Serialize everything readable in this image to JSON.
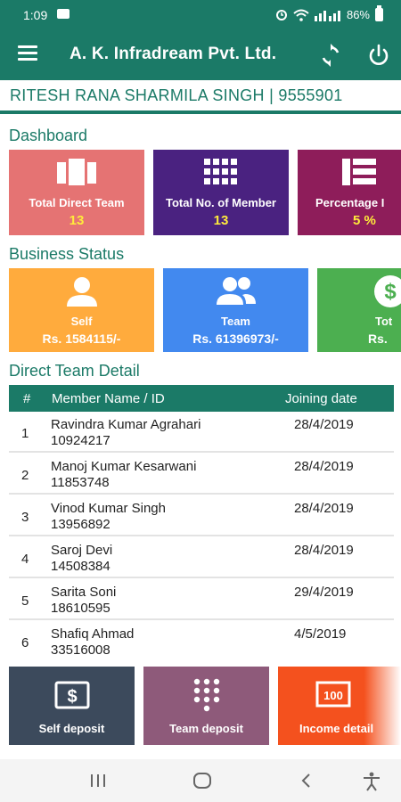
{
  "status": {
    "time": "1:09",
    "battery": "86%"
  },
  "appbar": {
    "title": "A. K. Infradream Pvt. Ltd."
  },
  "user": {
    "info": "RITESH RANA SHARMILA SINGH | 9555901"
  },
  "dashboard": {
    "heading": "Dashboard",
    "cards": [
      {
        "label": "Total Direct Team",
        "value": "13",
        "color": "#e57373",
        "icon": "team-columns-icon"
      },
      {
        "label": "Total No. of Member",
        "value": "13",
        "color": "#4a2280",
        "icon": "grid-icon"
      },
      {
        "label": "Percentage I",
        "value": "5 %",
        "color": "#8e1d5a",
        "icon": "list-icon"
      }
    ]
  },
  "business": {
    "heading": "Business Status",
    "cards": [
      {
        "label": "Self",
        "value": "Rs. 1584115/-",
        "color": "#ffab3d",
        "icon": "person-icon"
      },
      {
        "label": "Team",
        "value": "Rs. 61396973/-",
        "color": "#4289ef",
        "icon": "people-icon"
      },
      {
        "label": "Tot",
        "value": "Rs.",
        "color": "#4caf50",
        "icon": "currency-icon"
      }
    ]
  },
  "team_table": {
    "heading": "Direct Team Detail",
    "columns": [
      "#",
      "Member Name / ID",
      "Joining date"
    ],
    "rows": [
      {
        "num": "1",
        "name": "Ravindra Kumar Agrahari",
        "id": "10924217",
        "date": "28/4/2019"
      },
      {
        "num": "2",
        "name": "Manoj Kumar Kesarwani",
        "id": "11853748",
        "date": "28/4/2019"
      },
      {
        "num": "3",
        "name": "Vinod Kumar Singh",
        "id": "13956892",
        "date": "28/4/2019"
      },
      {
        "num": "4",
        "name": "Saroj Devi",
        "id": "14508384",
        "date": "28/4/2019"
      },
      {
        "num": "5",
        "name": "Sarita Soni",
        "id": "18610595",
        "date": "29/4/2019"
      },
      {
        "num": "6",
        "name": "Shafiq Ahmad",
        "id": "33516008",
        "date": "4/5/2019"
      }
    ]
  },
  "bottom_tiles": [
    {
      "label": "Self deposit",
      "color": "#3c4a5c",
      "icon": "dollar-icon"
    },
    {
      "label": "Team deposit",
      "color": "#8e5a7a",
      "icon": "keypad-icon"
    },
    {
      "label": "Income detail",
      "color": "#f4511e",
      "icon": "money-icon"
    }
  ]
}
